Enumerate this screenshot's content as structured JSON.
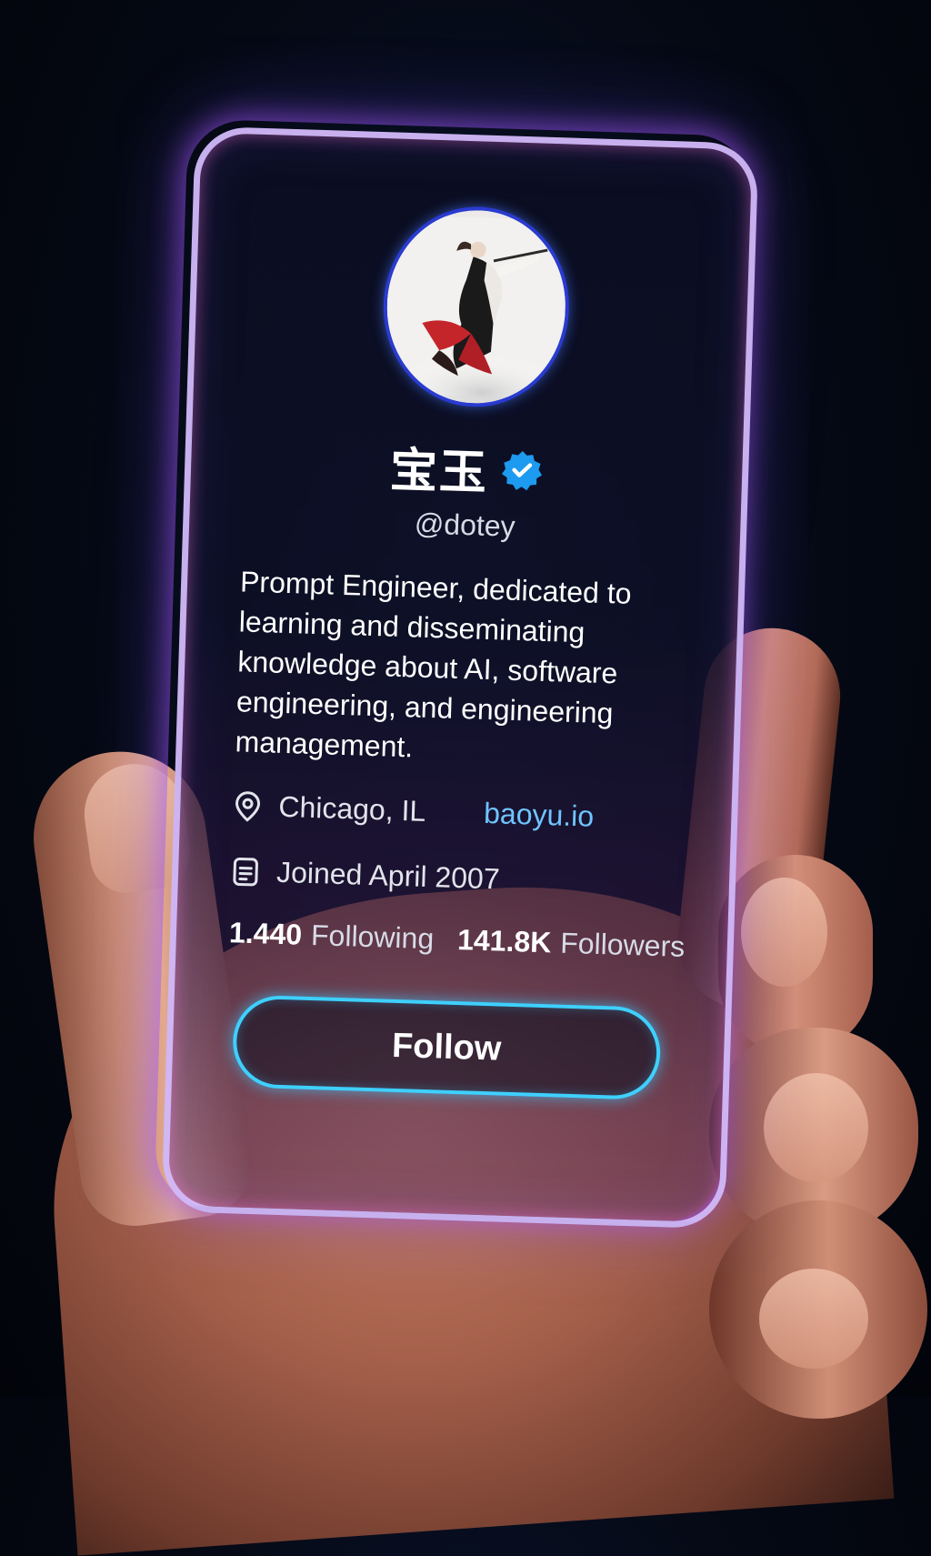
{
  "profile": {
    "display_name": "宝玉",
    "verified": true,
    "handle": "@dotey",
    "bio": "Prompt Engineer, dedicated to learning and disseminating knowledge about AI, software engineering, and engineering management."
  },
  "meta": {
    "location": "Chicago, IL",
    "website": "baoyu.io",
    "joined": "Joined April 2007"
  },
  "stats": {
    "following_count": "1.440",
    "following_label": "Following",
    "followers_count": "141.8K",
    "followers_label": "Followers"
  },
  "actions": {
    "follow_label": "Follow"
  },
  "icons": {
    "verified": "verified-badge-icon",
    "location": "map-pin-icon",
    "joined": "calendar-icon"
  },
  "colors": {
    "card_border": "#d7beff",
    "verified_badge": "#1d9bf0",
    "link": "#6fc4ff",
    "follow_border": "#3ed0ff",
    "glow": "#aa5aff"
  }
}
